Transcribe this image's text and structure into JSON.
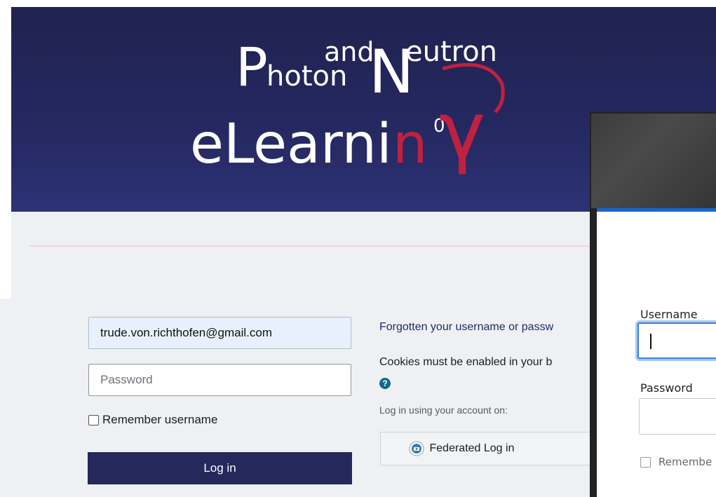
{
  "logo": {
    "photon_p": "P",
    "photon_rest": "hoton",
    "and": "and",
    "neutron_n": "N",
    "neutron_rest": "eutron",
    "elearning": "eLearni",
    "n_superscript": "n",
    "zero": "0",
    "gamma": "γ"
  },
  "login_form": {
    "username_value": "trude.von.richthofen@gmail.com",
    "password_placeholder": "Password",
    "remember_label": "Remember username",
    "login_button": "Log in"
  },
  "side_info": {
    "forgot_link": "Forgotten your username or passw",
    "cookies_text": "Cookies must be enabled in your b",
    "help_icon_glyph": "?",
    "login_using": "Log in using your account on:",
    "federated_button": "Federated Log in"
  },
  "second_window": {
    "username_label": "Username",
    "password_label": "Password",
    "remember_label": "Remembe"
  },
  "colors": {
    "banner": "#24285f",
    "login_button": "#25285a",
    "accent_red": "#c0213f",
    "window_blue": "#1866c9"
  }
}
